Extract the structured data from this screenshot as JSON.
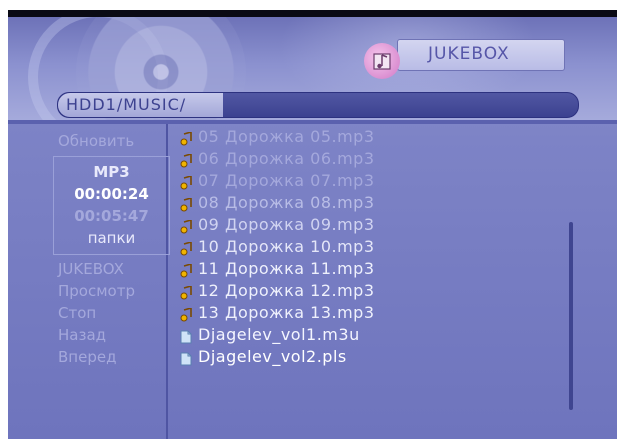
{
  "header": {
    "app_title": "JUKEBOX",
    "path": "HDD1/MUSIC/"
  },
  "sidebar": {
    "items_top": [
      "Обновить"
    ],
    "status": {
      "type": "MP3",
      "elapsed": "00:00:24",
      "total": "00:05:47",
      "folders": "папки"
    },
    "items_bottom": [
      "JUKEBOX",
      "Просмотр",
      "Стоп",
      "Назад",
      "Вперед"
    ]
  },
  "files": [
    {
      "name": "05 Дорожка 05.mp3",
      "kind": "audio"
    },
    {
      "name": "06 Дорожка 06.mp3",
      "kind": "audio"
    },
    {
      "name": "07 Дорожка 07.mp3",
      "kind": "audio"
    },
    {
      "name": "08 Дорожка 08.mp3",
      "kind": "audio"
    },
    {
      "name": "09 Дорожка 09.mp3",
      "kind": "audio"
    },
    {
      "name": "10 Дорожка 10.mp3",
      "kind": "audio"
    },
    {
      "name": "11 Дорожка 11.mp3",
      "kind": "audio"
    },
    {
      "name": "12 Дорожка 12.mp3",
      "kind": "audio"
    },
    {
      "name": "13 Дорожка 13.mp3",
      "kind": "audio"
    },
    {
      "name": "Djagelev_vol1.m3u",
      "kind": "playlist"
    },
    {
      "name": "Djagelev_vol2.pls",
      "kind": "playlist"
    }
  ],
  "colors": {
    "accent": "#5656a8",
    "text_dim": "#a4a8dc",
    "text_bright": "#ffffff",
    "highlight": "#e8e9fb"
  }
}
